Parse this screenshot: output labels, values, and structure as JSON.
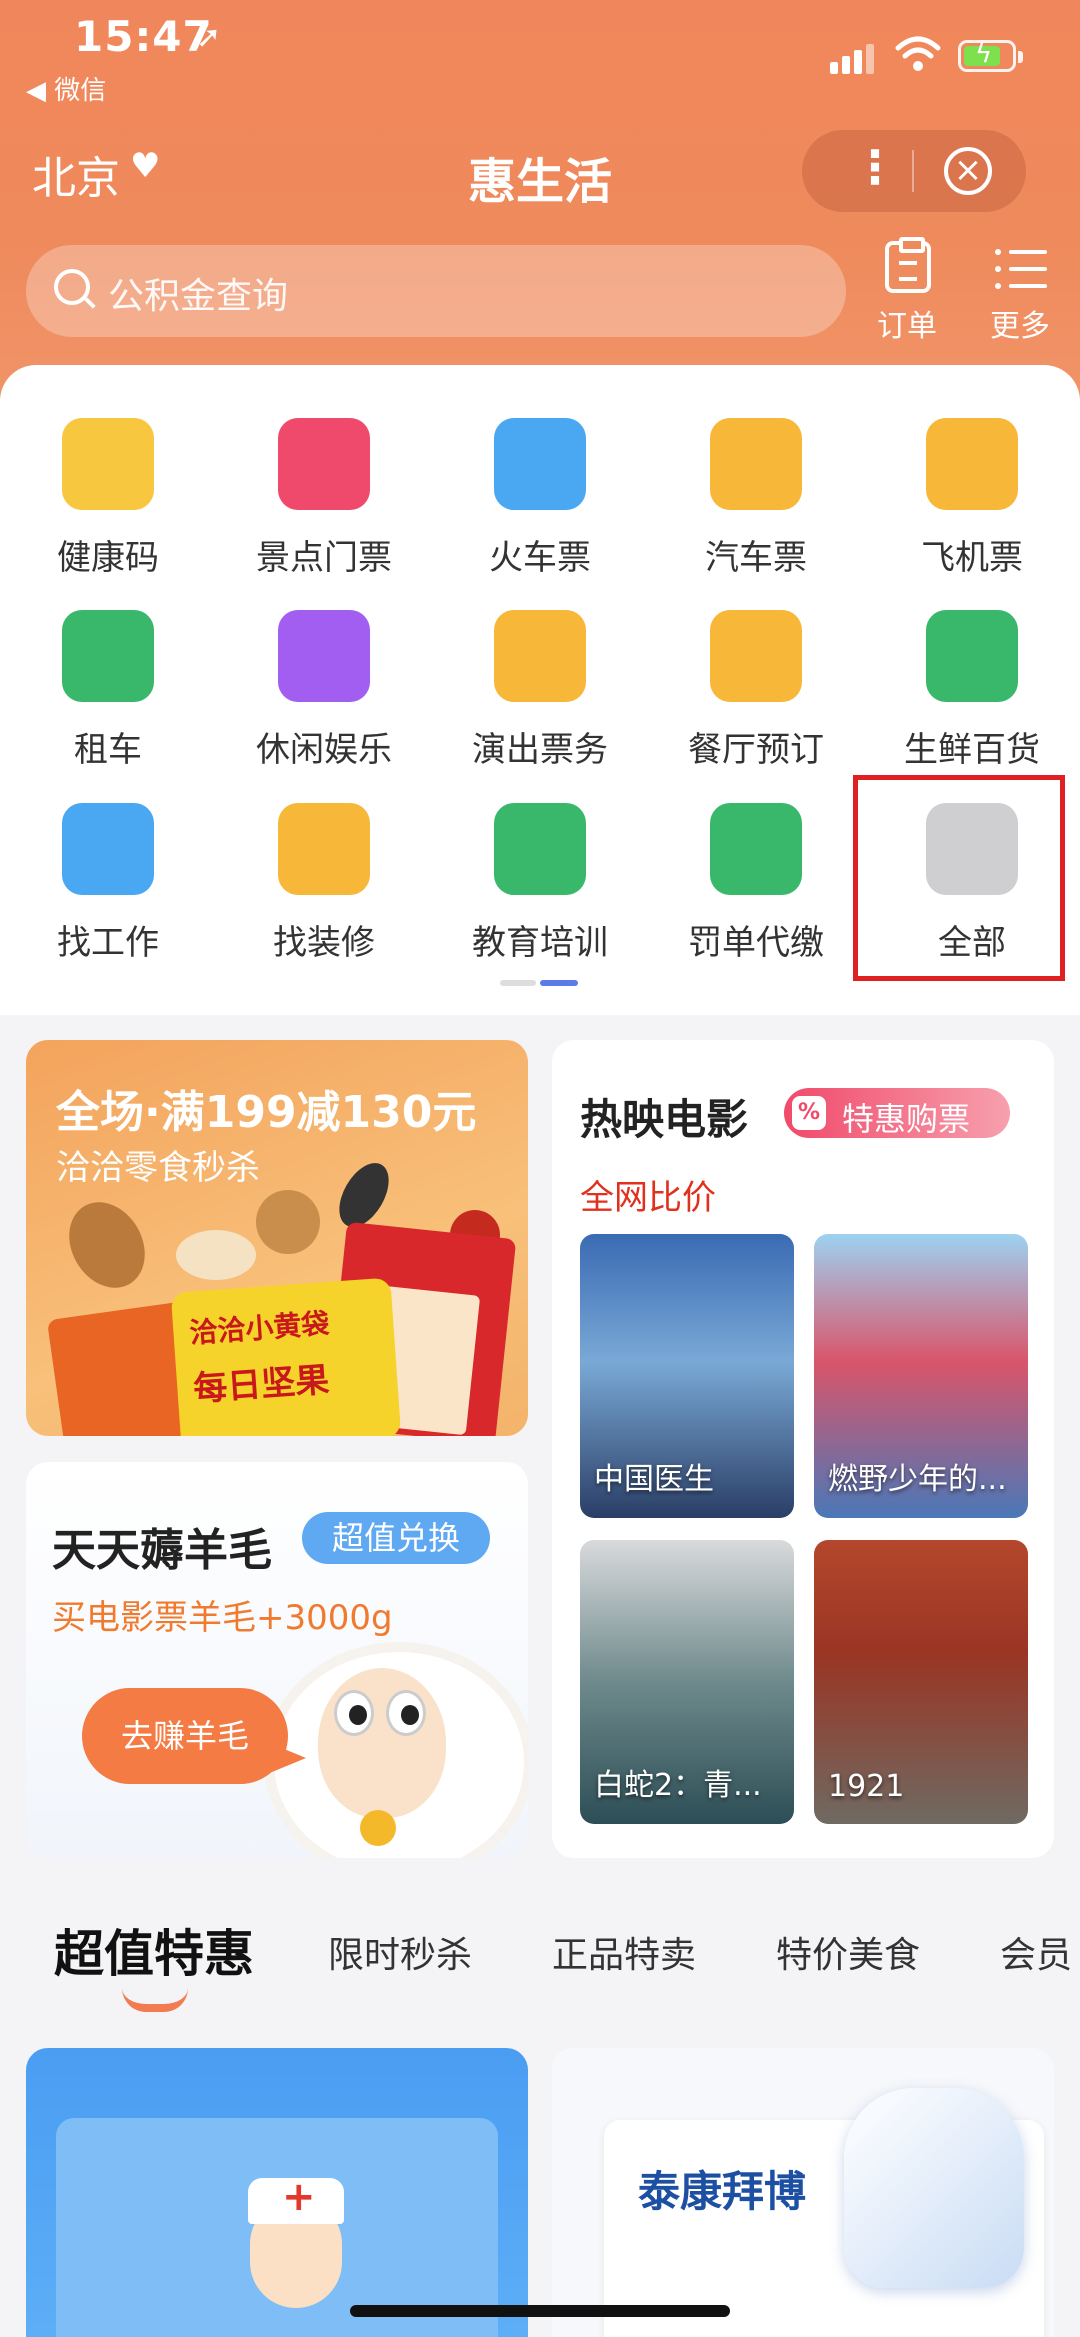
{
  "status_bar": {
    "time": "15:47",
    "back_app": "◀ 微信"
  },
  "nav": {
    "city": "北京",
    "title": "惠生活"
  },
  "search": {
    "placeholder": "公积金查询"
  },
  "top_actions": {
    "orders": "订单",
    "more": "更多"
  },
  "services": [
    {
      "label": "健康码",
      "icon": "health-code-icon",
      "color": "#f7c73f"
    },
    {
      "label": "景点门票",
      "icon": "attraction-ticket-icon",
      "color": "#ef4a6b"
    },
    {
      "label": "火车票",
      "icon": "train-icon",
      "color": "#4aa8f2"
    },
    {
      "label": "汽车票",
      "icon": "bus-icon",
      "color": "#f7b83a"
    },
    {
      "label": "飞机票",
      "icon": "flight-ticket-icon",
      "color": "#f7b83a"
    },
    {
      "label": "租车",
      "icon": "car-rental-icon",
      "color": "#39b86b"
    },
    {
      "label": "休闲娱乐",
      "icon": "leisure-icon",
      "color": "#a25ef0"
    },
    {
      "label": "演出票务",
      "icon": "show-ticket-icon",
      "color": "#f7b83a"
    },
    {
      "label": "餐厅预订",
      "icon": "restaurant-icon",
      "color": "#f7b83a"
    },
    {
      "label": "生鲜百货",
      "icon": "fresh-grocery-icon",
      "color": "#39b86b"
    },
    {
      "label": "找工作",
      "icon": "job-icon",
      "color": "#4aa8f2"
    },
    {
      "label": "找装修",
      "icon": "renovation-icon",
      "color": "#f7b83a"
    },
    {
      "label": "教育培训",
      "icon": "education-icon",
      "color": "#39b86b"
    },
    {
      "label": "罚单代缴",
      "icon": "fine-payment-icon",
      "color": "#39b86b"
    },
    {
      "label": "全部",
      "icon": "all-services-icon",
      "color": "#cfcfd2"
    }
  ],
  "promo_nuts": {
    "headline": "全场·满199减130元",
    "subline": "洽洽零食秒杀",
    "bag_text": "洽洽小黄袋",
    "bag_text2": "每日坚果"
  },
  "movies": {
    "title": "热映电影",
    "tag": "特惠购票",
    "subtitle": "全网比价",
    "posters": [
      {
        "caption": "中国医生"
      },
      {
        "caption": "燃野少年的..."
      },
      {
        "caption": "白蛇2：青..."
      },
      {
        "caption": "1921"
      }
    ]
  },
  "sheep": {
    "title": "天天薅羊毛",
    "tag": "超值兑换",
    "subtitle": "买电影票羊毛+3000g",
    "bubble": "去赚羊毛"
  },
  "tabs": [
    "超值特惠",
    "限时秒杀",
    "正品特卖",
    "特价美食",
    "会员"
  ],
  "bottom_right": {
    "brand": "泰康拜博"
  }
}
